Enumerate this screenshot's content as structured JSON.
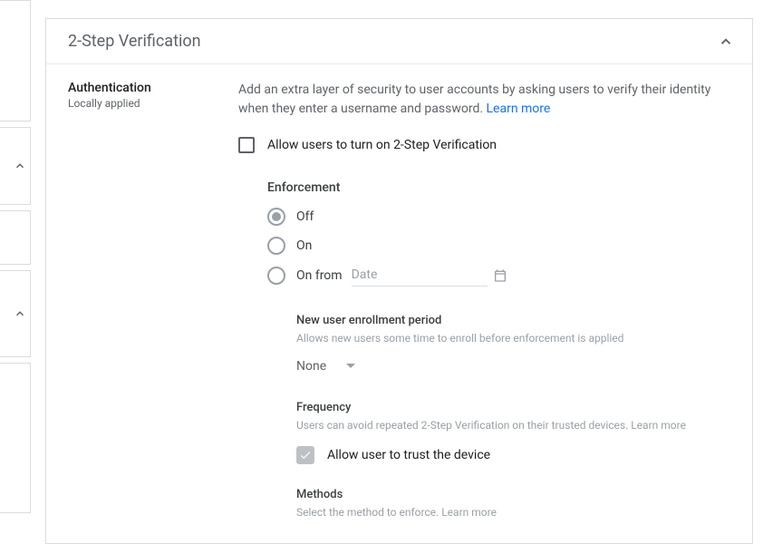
{
  "panel": {
    "title": "2-Step Verification"
  },
  "side": {
    "title": "Authentication",
    "subtitle": "Locally applied"
  },
  "description": {
    "text": "Add an extra layer of security to user accounts by asking users to verify their identity when they enter a username and password. ",
    "learn_more": "Learn more"
  },
  "allow_checkbox": {
    "label": "Allow users to turn on 2-Step Verification"
  },
  "enforcement": {
    "label": "Enforcement",
    "options": {
      "off": "Off",
      "on": "On",
      "on_from": "On from"
    },
    "date_placeholder": "Date"
  },
  "enrollment": {
    "label": "New user enrollment period",
    "sublabel": "Allows new users some time to enroll before enforcement is applied",
    "value": "None"
  },
  "frequency": {
    "label": "Frequency",
    "sublabel": "Users can avoid repeated 2-Step Verification on their trusted devices. ",
    "learn_more": "Learn more",
    "checkbox_label": "Allow user to trust the device"
  },
  "methods": {
    "label": "Methods",
    "sublabel": "Select the method to enforce. ",
    "learn_more": "Learn more"
  }
}
